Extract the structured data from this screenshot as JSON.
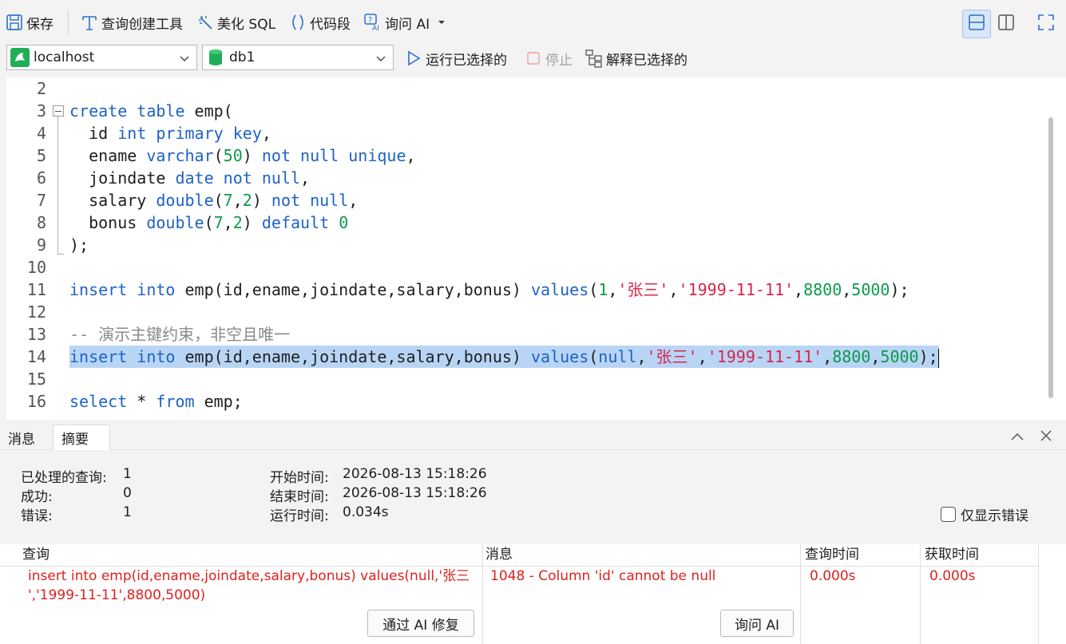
{
  "toolbar": {
    "save": "保存",
    "query_builder": "查询创建工具",
    "beautify": "美化 SQL",
    "snippet": "代码段",
    "ask_ai": "询问 AI"
  },
  "row2": {
    "connection": "localhost",
    "database": "db1",
    "run_selected": "运行已选择的",
    "stop": "停止",
    "explain_selected": "解释已选择的"
  },
  "editor": {
    "lines": [
      {
        "n": "2",
        "tokens": []
      },
      {
        "n": "3",
        "tokens": [
          [
            "kw",
            "create"
          ],
          [
            "t",
            " "
          ],
          [
            "kw",
            "table"
          ],
          [
            "t",
            " emp("
          ]
        ]
      },
      {
        "n": "4",
        "tokens": [
          [
            "t",
            "  id "
          ],
          [
            "kw",
            "int"
          ],
          [
            "t",
            " "
          ],
          [
            "kw",
            "primary"
          ],
          [
            "t",
            " "
          ],
          [
            "kw",
            "key"
          ],
          [
            "t",
            ","
          ]
        ]
      },
      {
        "n": "5",
        "tokens": [
          [
            "t",
            "  ename "
          ],
          [
            "kw",
            "varchar"
          ],
          [
            "t",
            "("
          ],
          [
            "num",
            "50"
          ],
          [
            "t",
            ") "
          ],
          [
            "kw",
            "not"
          ],
          [
            "t",
            " "
          ],
          [
            "kw",
            "null"
          ],
          [
            "t",
            " "
          ],
          [
            "kw",
            "unique"
          ],
          [
            "t",
            ","
          ]
        ]
      },
      {
        "n": "6",
        "tokens": [
          [
            "t",
            "  joindate "
          ],
          [
            "kw",
            "date"
          ],
          [
            "t",
            " "
          ],
          [
            "kw",
            "not"
          ],
          [
            "t",
            " "
          ],
          [
            "kw",
            "null"
          ],
          [
            "t",
            ","
          ]
        ]
      },
      {
        "n": "7",
        "tokens": [
          [
            "t",
            "  salary "
          ],
          [
            "kw",
            "double"
          ],
          [
            "t",
            "("
          ],
          [
            "num",
            "7"
          ],
          [
            "t",
            ","
          ],
          [
            "num",
            "2"
          ],
          [
            "t",
            ") "
          ],
          [
            "kw",
            "not"
          ],
          [
            "t",
            " "
          ],
          [
            "kw",
            "null"
          ],
          [
            "t",
            ","
          ]
        ]
      },
      {
        "n": "8",
        "tokens": [
          [
            "t",
            "  bonus "
          ],
          [
            "kw",
            "double"
          ],
          [
            "t",
            "("
          ],
          [
            "num",
            "7"
          ],
          [
            "t",
            ","
          ],
          [
            "num",
            "2"
          ],
          [
            "t",
            ") "
          ],
          [
            "kw",
            "default"
          ],
          [
            "t",
            " "
          ],
          [
            "num",
            "0"
          ]
        ]
      },
      {
        "n": "9",
        "tokens": [
          [
            "t",
            ");"
          ]
        ]
      },
      {
        "n": "10",
        "tokens": []
      },
      {
        "n": "11",
        "tokens": [
          [
            "kw",
            "insert"
          ],
          [
            "t",
            " "
          ],
          [
            "kw",
            "into"
          ],
          [
            "t",
            " emp(id,ename,joindate,salary,bonus) "
          ],
          [
            "kw",
            "values"
          ],
          [
            "t",
            "("
          ],
          [
            "num",
            "1"
          ],
          [
            "t",
            ","
          ],
          [
            "str",
            "'张三'"
          ],
          [
            "t",
            ","
          ],
          [
            "str",
            "'1999-11-11'"
          ],
          [
            "t",
            ","
          ],
          [
            "num",
            "8800"
          ],
          [
            "t",
            ","
          ],
          [
            "num",
            "5000"
          ],
          [
            "t",
            ");"
          ]
        ]
      },
      {
        "n": "12",
        "tokens": []
      },
      {
        "n": "13",
        "tokens": [
          [
            "cmt",
            "-- 演示主键约束，非空且唯一"
          ]
        ]
      },
      {
        "n": "14",
        "highlight": true,
        "tokens": [
          [
            "kw",
            "insert"
          ],
          [
            "t",
            " "
          ],
          [
            "kw",
            "into"
          ],
          [
            "t",
            " emp(id,ename,joindate,salary,bonus) "
          ],
          [
            "kw",
            "values"
          ],
          [
            "t",
            "("
          ],
          [
            "kw",
            "null"
          ],
          [
            "t",
            ","
          ],
          [
            "str",
            "'张三'"
          ],
          [
            "t",
            ","
          ],
          [
            "str",
            "'1999-11-11'"
          ],
          [
            "t",
            ","
          ],
          [
            "num",
            "8800"
          ],
          [
            "t",
            ","
          ],
          [
            "num",
            "5000"
          ],
          [
            "t",
            ");"
          ]
        ]
      },
      {
        "n": "15",
        "tokens": []
      },
      {
        "n": "16",
        "tokens": [
          [
            "kw",
            "select"
          ],
          [
            "t",
            " * "
          ],
          [
            "kw",
            "from"
          ],
          [
            "t",
            " emp;"
          ]
        ]
      }
    ]
  },
  "tabs": {
    "messages": "消息",
    "summary": "摘要"
  },
  "summary": {
    "processed_label": "已处理的查询:",
    "processed_value": "1",
    "success_label": "成功:",
    "success_value": "0",
    "error_label": "错误:",
    "error_value": "1",
    "start_label": "开始时间:",
    "start_value": "2026-08-13 15:18:26",
    "end_label": "结束时间:",
    "end_value": "2026-08-13 15:18:26",
    "run_label": "运行时间:",
    "run_value": "0.034s",
    "only_errors": "仅显示错误"
  },
  "grid": {
    "headers": [
      "查询",
      "消息",
      "查询时间",
      "获取时间"
    ],
    "row": {
      "query_line1": "insert into emp(id,ename,joindate,salary,bonus) values(null,'张三",
      "query_line2": "','1999-11-11',8800,5000)",
      "message": "1048 - Column 'id' cannot be null",
      "query_time": "0.000s",
      "fetch_time": "0.000s"
    },
    "fix_button": "通过 AI 修复",
    "ask_button": "询问 AI"
  },
  "colors": {
    "keyword": "#1d62c7",
    "number": "#0d9a4c",
    "string": "#d7264a",
    "error": "#e02020",
    "selection": "#b9d5f5"
  }
}
